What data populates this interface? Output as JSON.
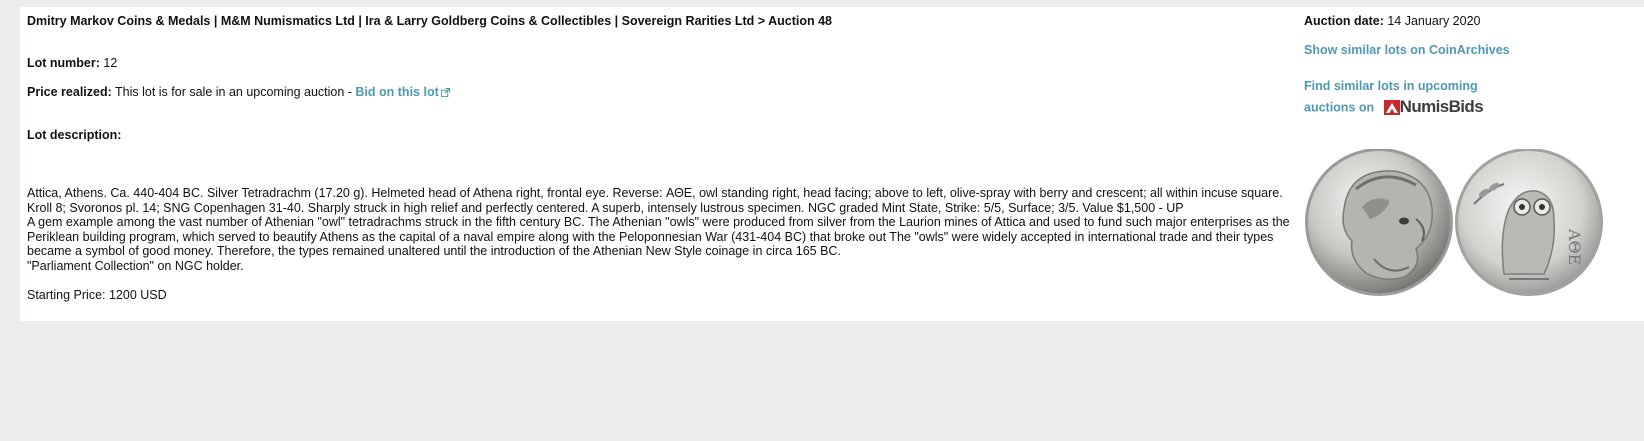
{
  "header": {
    "breadcrumb": "Dmitry Markov Coins & Medals | M&M Numismatics Ltd | Ira & Larry Goldberg Coins & Collectibles | Sovereign Rarities Ltd > Auction 48"
  },
  "lot": {
    "number_label": "Lot number:",
    "number": "12",
    "price_label": "Price realized:",
    "price_text": "This lot is for sale in an upcoming auction -",
    "bid_link": "Bid on this lot",
    "description_label": "Lot description:",
    "description_lines": [
      "Attica, Athens. Ca. 440-404 BC. Silver Tetradrachm (17.20 g). Helmeted head of Athena right, frontal eye. Reverse: ΑΘΕ, owl standing right, head facing; above to left, olive-spray with berry and crescent; all within incuse square. Kroll 8; Svoronos pl. 14; SNG Copenhagen 31-40. Sharply struck in high relief and perfectly centered. A superb, intensely lustrous specimen. NGC graded Mint State, Strike: 5/5, Surface; 3/5. Value $1,500 - UP",
      "A gem example among the vast number of Athenian \"owl\" tetradrachms struck in the fifth century BC. The Athenian \"owls\" were produced from silver from the Laurion mines of Attica and used to fund such major enterprises as the Periklean building program, which served to beautify Athens as the capital of a naval empire along with the Peloponnesian War (431-404 BC) that broke out The \"owls\" were widely accepted in international trade and their types became a symbol of good money. Therefore, the types remained unaltered until the introduction of the Athenian New Style coinage in circa 165 BC.",
      "\"Parliament Collection\" on NGC holder."
    ],
    "starting_price": "Starting Price: 1200 USD"
  },
  "sidebar": {
    "auction_date_label": "Auction date:",
    "auction_date": "14 January 2020",
    "similar_link": "Show similar lots on CoinArchives",
    "upcoming_line1": "Find similar lots in upcoming",
    "upcoming_line2": "auctions on",
    "numisbids_logo": "NumisBids"
  },
  "colors": {
    "link": "#4f97b3",
    "background": "#eceeed",
    "panel": "#ffffff",
    "logo_red": "#c8282e"
  }
}
